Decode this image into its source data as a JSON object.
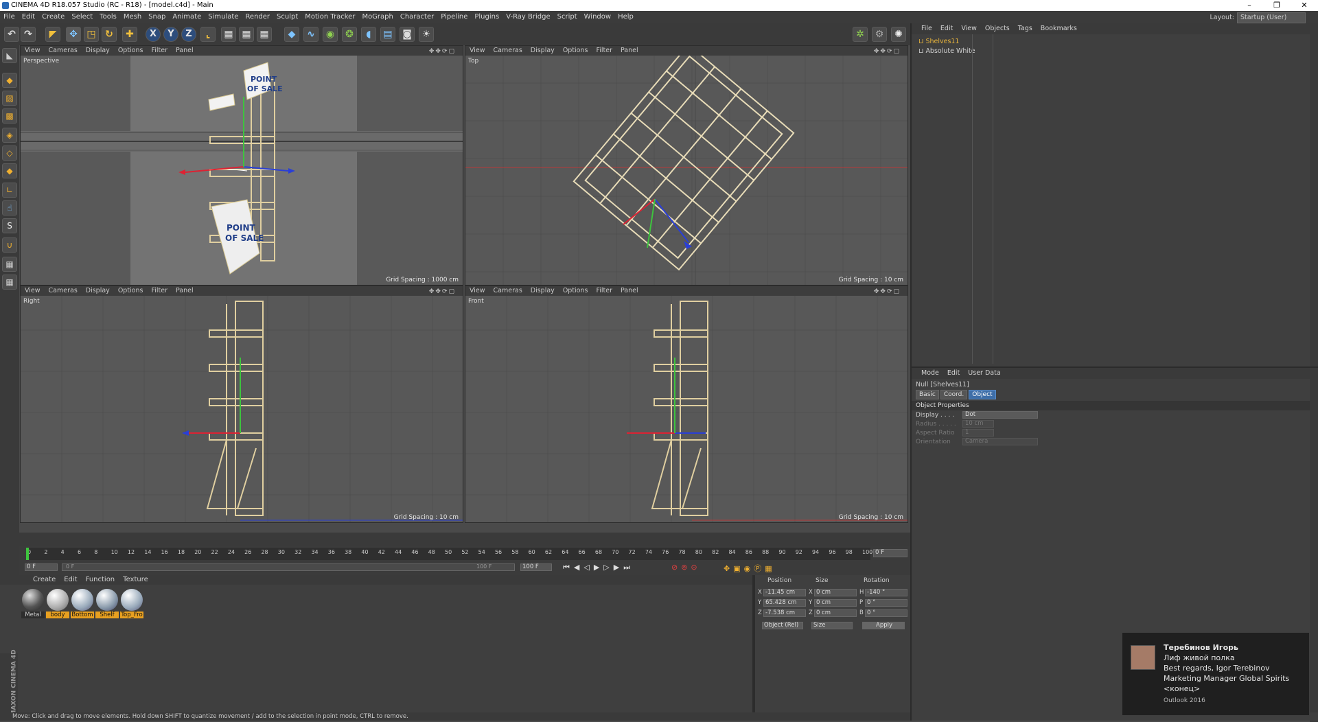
{
  "window": {
    "title": "CINEMA 4D R18.057 Studio (RC - R18) - [model.c4d] - Main"
  },
  "menubar": {
    "items": [
      "File",
      "Edit",
      "Create",
      "Select",
      "Tools",
      "Mesh",
      "Snap",
      "Animate",
      "Simulate",
      "Render",
      "Sculpt",
      "Motion Tracker",
      "MoGraph",
      "Character",
      "Pipeline",
      "Plugins",
      "V-Ray Bridge",
      "Script",
      "Window",
      "Help"
    ],
    "layout_label": "Layout:",
    "layout_value": "Startup (User)"
  },
  "toolbar": {
    "axis_x": "X",
    "axis_y": "Y",
    "axis_z": "Z"
  },
  "viewports": {
    "menu": [
      "View",
      "Cameras",
      "Display",
      "Options",
      "Filter",
      "Panel"
    ],
    "perspective": {
      "name": "Perspective",
      "grid": "Grid Spacing : 1000 cm"
    },
    "top": {
      "name": "Top",
      "grid": "Grid Spacing : 10 cm"
    },
    "right": {
      "name": "Right",
      "grid": "Grid Spacing : 10 cm"
    },
    "front": {
      "name": "Front",
      "grid": "Grid Spacing : 10 cm"
    },
    "sign_text_1": "POINT",
    "sign_text_2": "OF SALE",
    "shelf_text": "POINT OF SALE"
  },
  "object_manager": {
    "menu": [
      "File",
      "Edit",
      "View",
      "Objects",
      "Tags",
      "Bookmarks"
    ],
    "objects": [
      {
        "name": "Shelves11",
        "color": "#e8b43c"
      },
      {
        "name": "Absolute White",
        "color": "#cfcfcf"
      }
    ]
  },
  "attribute_manager": {
    "menu": [
      "Mode",
      "Edit",
      "User Data"
    ],
    "object_title": "Null [Shelves11]",
    "tabs": [
      "Basic",
      "Coord.",
      "Object"
    ],
    "active_tab": "Object",
    "section": "Object Properties",
    "props": [
      {
        "label": "Display . . . .",
        "value": "Dot"
      },
      {
        "label": "Radius . . . . .",
        "value": "10 cm"
      },
      {
        "label": "Aspect Ratio",
        "value": "1"
      },
      {
        "label": "Orientation",
        "value": "Camera"
      }
    ]
  },
  "timeline": {
    "ticks": [
      "0",
      "2",
      "4",
      "6",
      "8",
      "10",
      "12",
      "14",
      "16",
      "18",
      "20",
      "22",
      "24",
      "26",
      "28",
      "30",
      "32",
      "34",
      "36",
      "38",
      "40",
      "42",
      "44",
      "46",
      "48",
      "50",
      "52",
      "54",
      "56",
      "58",
      "60",
      "62",
      "64",
      "66",
      "68",
      "70",
      "72",
      "74",
      "76",
      "78",
      "80",
      "82",
      "84",
      "86",
      "88",
      "90",
      "92",
      "94",
      "96",
      "98",
      "100"
    ],
    "current_frame": "0 F",
    "start_frame": "0 F",
    "range_start": "0 F",
    "range_end": "100 F",
    "end_frame": "100 F",
    "frame_display": "0 F"
  },
  "material_manager": {
    "menu": [
      "Create",
      "Edit",
      "Function",
      "Texture"
    ],
    "materials": [
      {
        "name": "Metal",
        "highlight": false
      },
      {
        "name": "body",
        "highlight": true
      },
      {
        "name": "Bottom",
        "highlight": true
      },
      {
        "name": "Shelf",
        "highlight": true
      },
      {
        "name": "Top_Fro",
        "highlight": true
      }
    ]
  },
  "coordinates": {
    "headers": [
      "Position",
      "Size",
      "Rotation"
    ],
    "rows": [
      {
        "axis": "X",
        "pos": "-11.45 cm",
        "size_axis": "X",
        "size": "0 cm",
        "rot_axis": "H",
        "rot": "-140 °"
      },
      {
        "axis": "Y",
        "pos": "65.428 cm",
        "size_axis": "Y",
        "size": "0 cm",
        "rot_axis": "P",
        "rot": "0 °"
      },
      {
        "axis": "Z",
        "pos": "-7.538 cm",
        "size_axis": "Z",
        "size": "0 cm",
        "rot_axis": "B",
        "rot": "0 °"
      }
    ],
    "mode": "Object (Rel)",
    "size_mode": "Size",
    "apply": "Apply"
  },
  "status": "Move: Click and drag to move elements. Hold down SHIFT to quantize movement / add to the selection in point mode, CTRL to remove.",
  "brand": "MAXON CINEMA 4D",
  "notification": {
    "sender": "Теребинов Игорь",
    "subject": "Лиф живой полка",
    "line1": "Best regards,  Igor Terebinov",
    "line2": "Marketing Manager  Global Spirits",
    "line3": "<конец>",
    "app": "Outlook 2016"
  }
}
